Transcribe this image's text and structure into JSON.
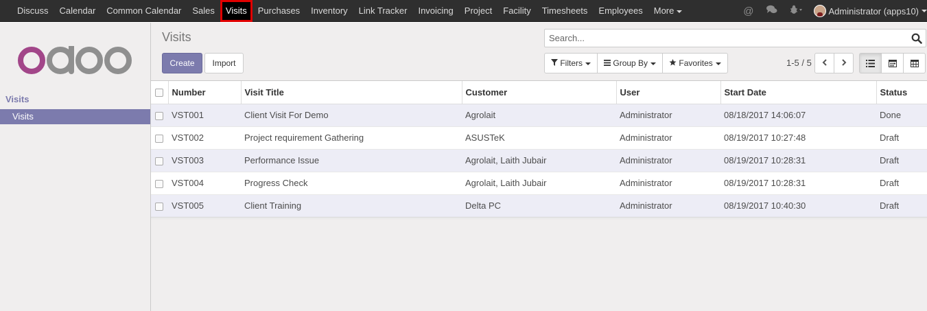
{
  "topnav": {
    "menu": [
      "Discuss",
      "Calendar",
      "Common Calendar",
      "Sales",
      "Visits",
      "Purchases",
      "Inventory",
      "Link Tracker",
      "Invoicing",
      "Project",
      "Facility",
      "Timesheets",
      "Employees"
    ],
    "more_label": "More",
    "active": "Visits",
    "user": "Administrator (apps10)",
    "highlight_color": "#e10000"
  },
  "sidebar": {
    "logo_text": "odoo",
    "section": "Visits",
    "items": [
      {
        "label": "Visits"
      }
    ]
  },
  "control_panel": {
    "title": "Visits",
    "create_label": "Create",
    "import_label": "Import",
    "search_placeholder": "Search...",
    "filters_label": "Filters",
    "groupby_label": "Group By",
    "favorites_label": "Favorites",
    "pager": "1-5 / 5"
  },
  "table": {
    "columns": [
      "Number",
      "Visit Title",
      "Customer",
      "User",
      "Start Date",
      "Status"
    ],
    "rows": [
      [
        "VST001",
        "Client Visit For Demo",
        "Agrolait",
        "Administrator",
        "08/18/2017 14:06:07",
        "Done"
      ],
      [
        "VST002",
        "Project requirement Gathering",
        "ASUSTeK",
        "Administrator",
        "08/19/2017 10:27:48",
        "Draft"
      ],
      [
        "VST003",
        "Performance Issue",
        "Agrolait, Laith Jubair",
        "Administrator",
        "08/19/2017 10:28:31",
        "Draft"
      ],
      [
        "VST004",
        "Progress Check",
        "Agrolait, Laith Jubair",
        "Administrator",
        "08/19/2017 10:28:31",
        "Draft"
      ],
      [
        "VST005",
        "Client Training",
        "Delta PC",
        "Administrator",
        "08/19/2017 10:40:30",
        "Draft"
      ]
    ]
  },
  "colors": {
    "brand": "#7c7bad",
    "topbar": "#2f2f2f",
    "row_alt": "#ededf6"
  }
}
